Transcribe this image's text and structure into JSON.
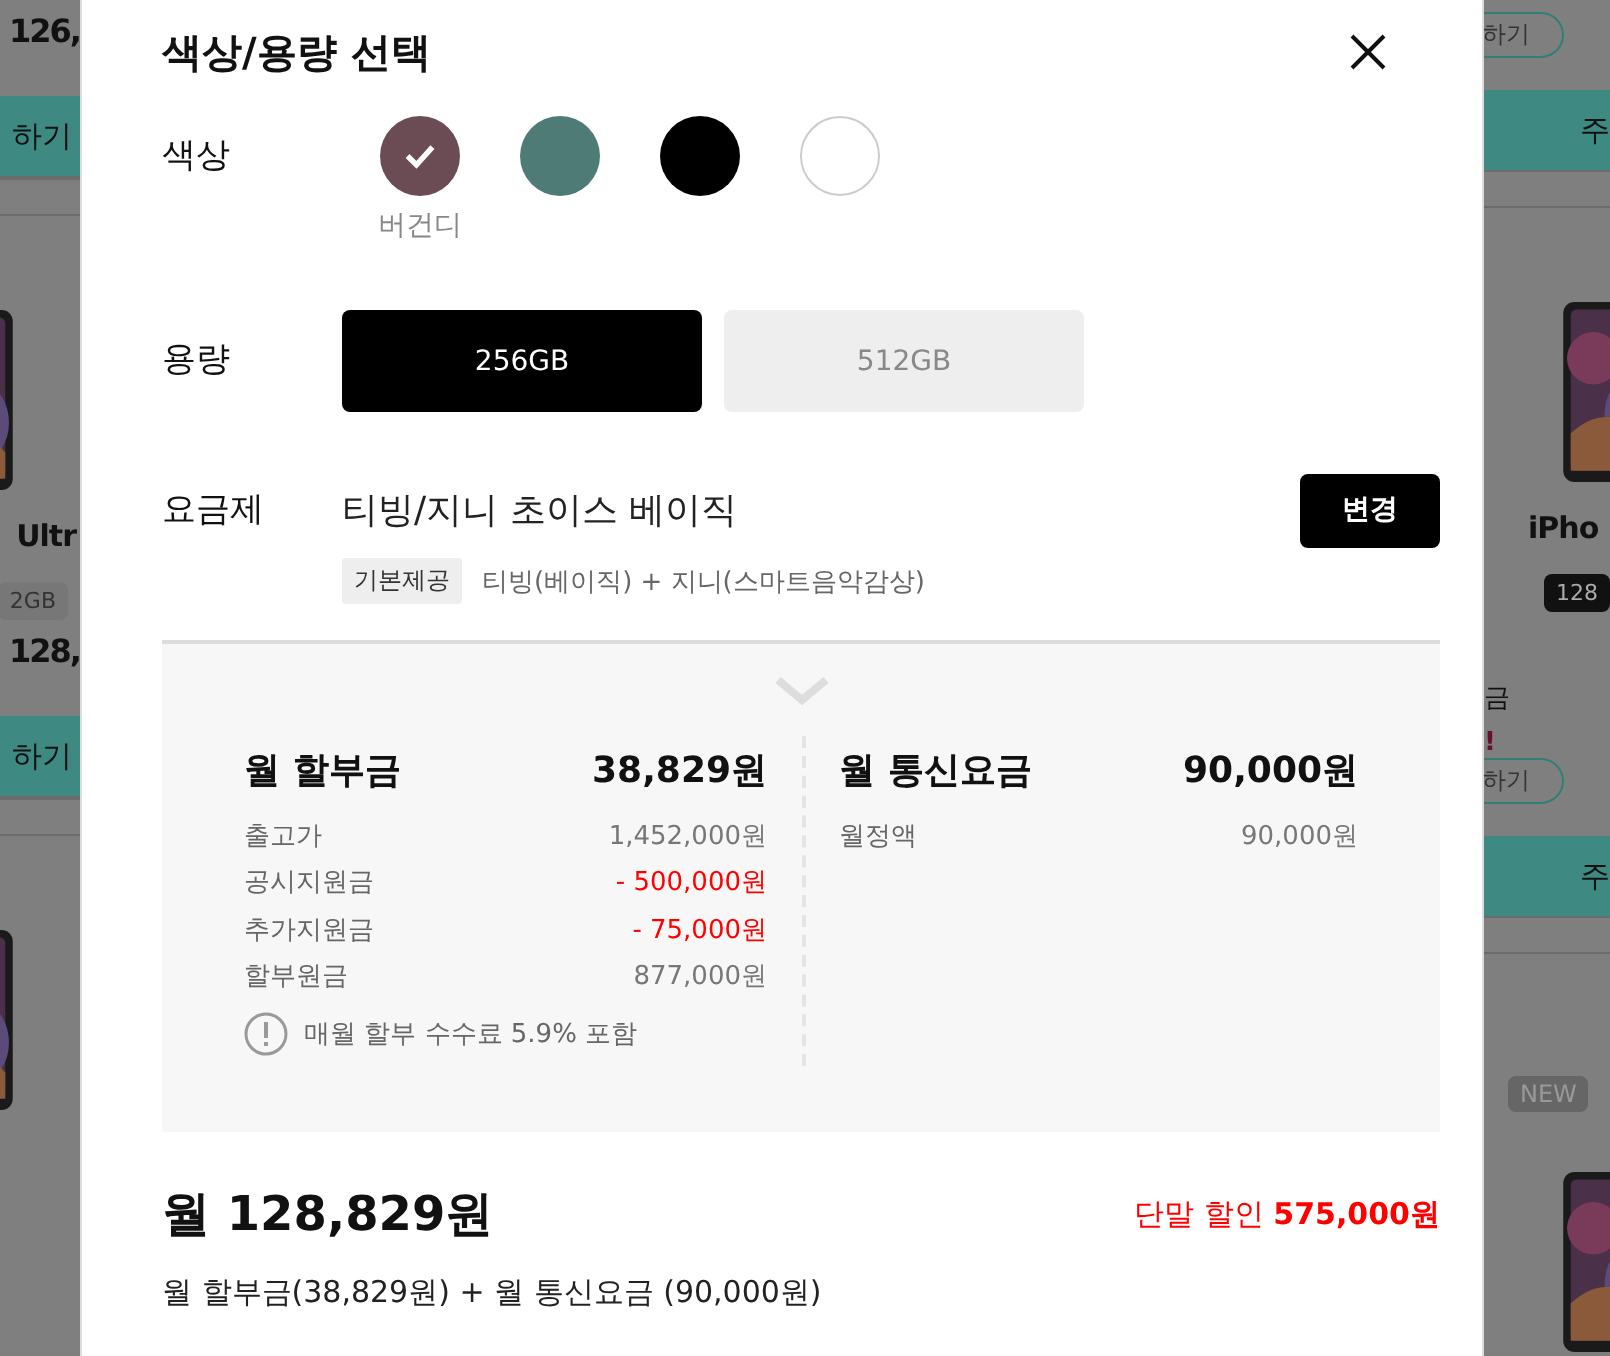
{
  "background": {
    "left": [
      {
        "kind": "price",
        "text": "126,"
      },
      {
        "kind": "bar",
        "text": "하기"
      },
      {
        "kind": "picture"
      },
      {
        "kind": "name",
        "text": "Ultr"
      },
      {
        "kind": "chip",
        "text": "2GB"
      },
      {
        "kind": "price",
        "text": "128,"
      },
      {
        "kind": "bar",
        "text": "하기"
      },
      {
        "kind": "picture"
      }
    ],
    "right": [
      {
        "kind": "outline",
        "text": "하기"
      },
      {
        "kind": "bar",
        "text": "주"
      },
      {
        "kind": "picture"
      },
      {
        "kind": "name",
        "text": "iPho"
      },
      {
        "kind": "chip",
        "text": "128"
      },
      {
        "kind": "note",
        "text": "금"
      },
      {
        "kind": "alert",
        "text": "!"
      },
      {
        "kind": "outline",
        "text": "하기"
      },
      {
        "kind": "bar",
        "text": "주"
      },
      {
        "kind": "tag",
        "text": "NEW"
      },
      {
        "kind": "picture"
      }
    ]
  },
  "dialog": {
    "title": "색상/용량 선택",
    "color_label": "색상",
    "colors": [
      {
        "color": "#6b4c55",
        "selected": true,
        "label": "버건디"
      },
      {
        "color": "#4e7b76",
        "selected": false
      },
      {
        "color": "#000000",
        "selected": false
      },
      {
        "color": "#ffffff",
        "selected": false
      }
    ],
    "capacity_label": "용량",
    "capacities": [
      {
        "label": "256GB",
        "selected": true
      },
      {
        "label": "512GB",
        "selected": false
      }
    ],
    "plan_label": "요금제",
    "plan_name": "티빙/지니 초이스 베이직",
    "plan_button": "변경",
    "plan_tag": "기본제공",
    "plan_desc": "티빙(베이직) + 지니(스마트음악감상)",
    "installment": {
      "title": "월 할부금",
      "amount": "38,829원",
      "rows": [
        {
          "kind": "normal",
          "label": "출고가",
          "value": "1,452,000원"
        },
        {
          "kind": "discount",
          "label": "공시지원금",
          "value": "- 500,000원"
        },
        {
          "kind": "discount",
          "label": "추가지원금",
          "value": "- 75,000원"
        },
        {
          "kind": "normal",
          "label": "할부원금",
          "value": "877,000원"
        }
      ],
      "note": "매월 할부 수수료 5.9% 포함"
    },
    "service": {
      "title": "월 통신요금",
      "amount": "90,000원",
      "rows": [
        {
          "kind": "normal",
          "label": "월정액",
          "value": "90,000원"
        }
      ]
    },
    "total": "월 128,829원",
    "discount": "단말 할인 **575,000원**",
    "breakdown": "월 할부금(38,829원) + 월 통신요금 (90,000원)"
  }
}
